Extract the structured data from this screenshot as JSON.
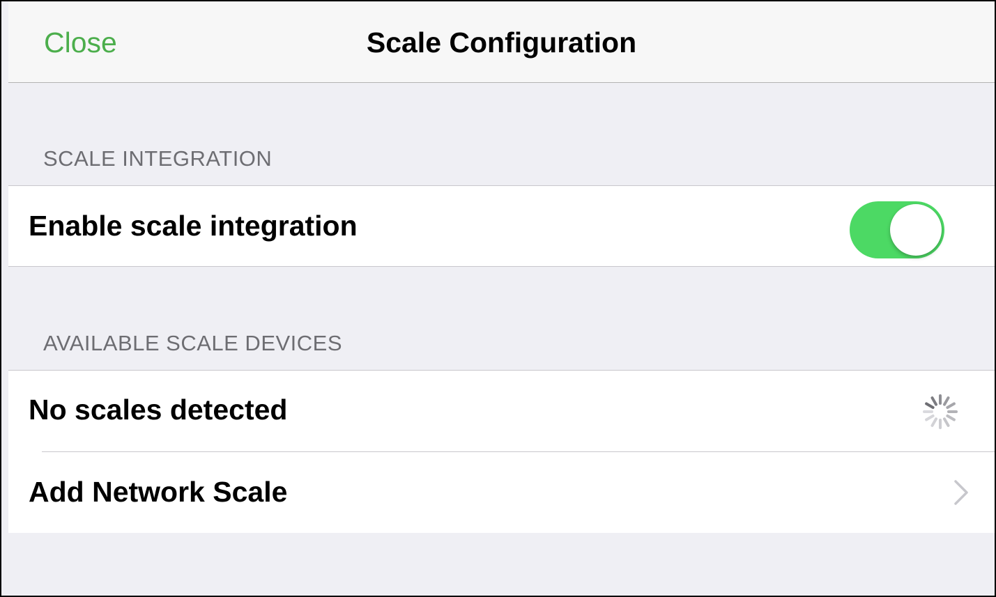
{
  "navbar": {
    "close_label": "Close",
    "title": "Scale Configuration"
  },
  "sections": {
    "integration": {
      "header": "SCALE INTEGRATION",
      "enable_label": "Enable scale integration",
      "enabled": true
    },
    "devices": {
      "header": "AVAILABLE SCALE DEVICES",
      "status_label": "No scales detected",
      "add_label": "Add Network Scale"
    }
  },
  "icons": {
    "spinner": "activity-indicator-icon",
    "chevron": "chevron-right-icon"
  },
  "colors": {
    "accent": "#4cae4c",
    "switch_on": "#4cd964",
    "background": "#efeff4",
    "header_text": "#6d6d72",
    "separator": "#c8c7cc",
    "chevron": "#c7c7cc"
  }
}
